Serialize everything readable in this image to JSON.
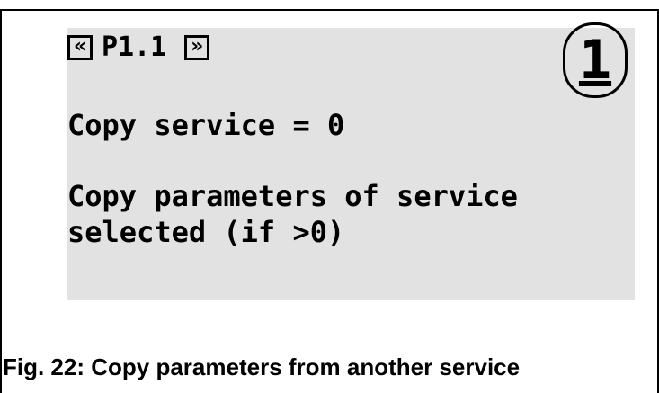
{
  "screen": {
    "nav_prev_label": "«",
    "page_id": "P1.1",
    "nav_next_label": "»",
    "access_level": "1",
    "setting_text": "Copy service = 0",
    "description_line1": "Copy parameters of service",
    "description_line2": "selected (if >0)"
  },
  "caption": "Fig. 22: Copy parameters from another service"
}
